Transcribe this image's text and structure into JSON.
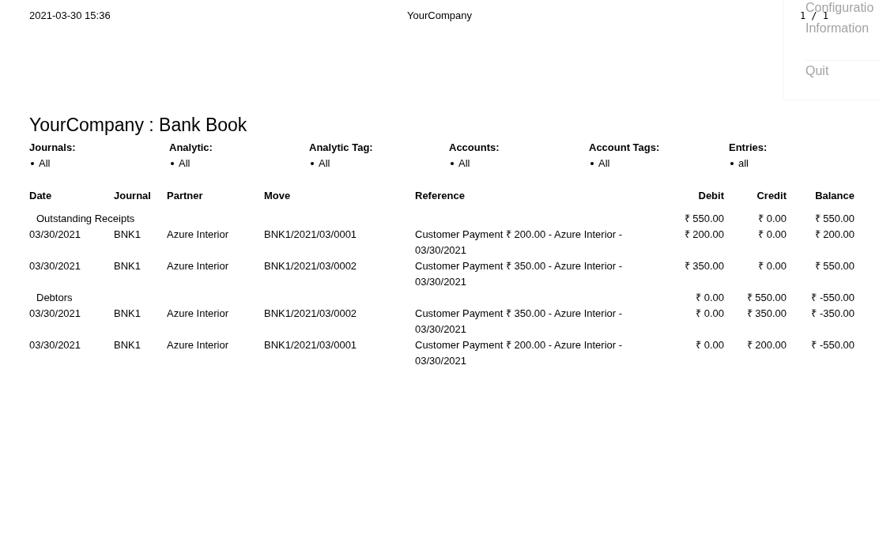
{
  "header": {
    "datetime": "2021-03-30 15:36",
    "company": "YourCompany",
    "page": "1 / 1"
  },
  "menu": {
    "items": [
      "Configuratio",
      "Information",
      "Quit"
    ]
  },
  "title": "YourCompany : Bank Book",
  "filters": [
    {
      "label": "Journals:",
      "values": [
        "All"
      ]
    },
    {
      "label": "Analytic:",
      "values": [
        "All"
      ]
    },
    {
      "label": "Analytic Tag:",
      "values": [
        "All"
      ]
    },
    {
      "label": "Accounts:",
      "values": [
        "All"
      ]
    },
    {
      "label": "Account Tags:",
      "values": [
        "All"
      ]
    },
    {
      "label": "Entries:",
      "values": [
        "all"
      ]
    }
  ],
  "table": {
    "columns": [
      "Date",
      "Journal",
      "Partner",
      "Move",
      "Reference",
      "Debit",
      "Credit",
      "Balance"
    ],
    "rows": [
      {
        "kind": "group",
        "name": "Outstanding Receipts",
        "debit": "₹ 550.00",
        "credit": "₹ 0.00",
        "balance": "₹ 550.00"
      },
      {
        "kind": "line",
        "date": "03/30/2021",
        "journal": "BNK1",
        "partner": "Azure Interior",
        "move": "BNK1/2021/03/0001",
        "reference": "Customer Payment ₹ 200.00 - Azure Interior - 03/30/2021",
        "debit": "₹ 200.00",
        "credit": "₹ 0.00",
        "balance": "₹ 200.00"
      },
      {
        "kind": "line",
        "date": "03/30/2021",
        "journal": "BNK1",
        "partner": "Azure Interior",
        "move": "BNK1/2021/03/0002",
        "reference": "Customer Payment ₹ 350.00 - Azure Interior - 03/30/2021",
        "debit": "₹ 350.00",
        "credit": "₹ 0.00",
        "balance": "₹ 550.00"
      },
      {
        "kind": "group",
        "name": "Debtors",
        "debit": "₹ 0.00",
        "credit": "₹ 550.00",
        "balance": "₹ -550.00"
      },
      {
        "kind": "line",
        "date": "03/30/2021",
        "journal": "BNK1",
        "partner": "Azure Interior",
        "move": "BNK1/2021/03/0002",
        "reference": "Customer Payment ₹ 350.00 - Azure Interior - 03/30/2021",
        "debit": "₹ 0.00",
        "credit": "₹ 350.00",
        "balance": "₹ -350.00"
      },
      {
        "kind": "line",
        "date": "03/30/2021",
        "journal": "BNK1",
        "partner": "Azure Interior",
        "move": "BNK1/2021/03/0001",
        "reference": "Customer Payment ₹ 200.00 - Azure Interior - 03/30/2021",
        "debit": "₹ 0.00",
        "credit": "₹ 200.00",
        "balance": "₹ -550.00"
      }
    ]
  }
}
